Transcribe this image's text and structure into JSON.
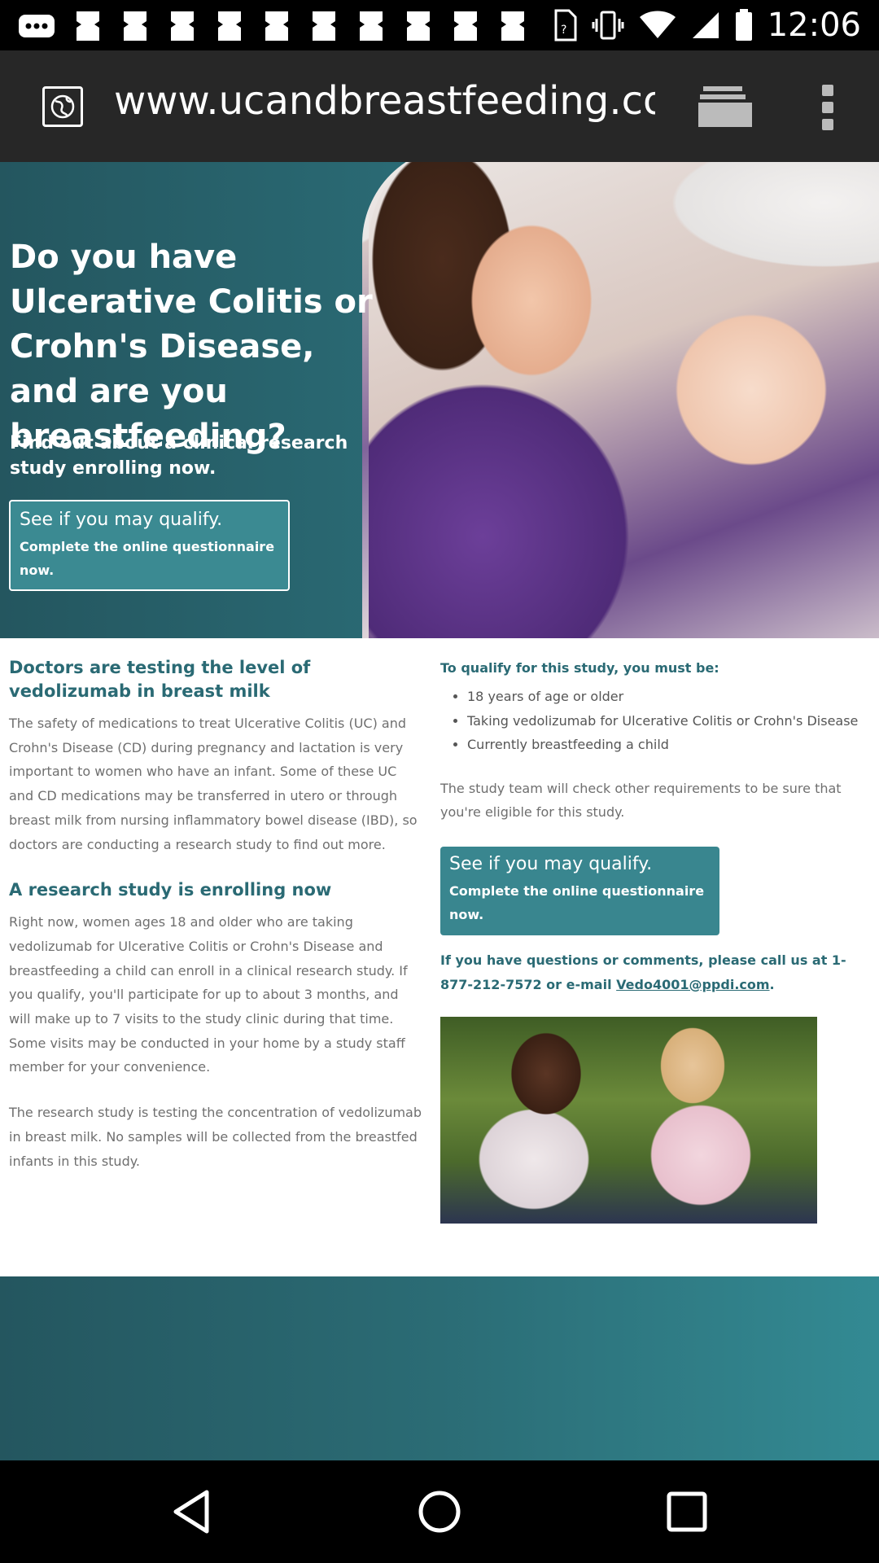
{
  "status_bar": {
    "time": "12:06",
    "icons": [
      "more-notifications-icon",
      "app-notification-icon",
      "app-notification-icon",
      "app-notification-icon",
      "app-notification-icon",
      "app-notification-icon",
      "app-notification-icon",
      "app-notification-icon",
      "app-notification-icon",
      "app-notification-icon",
      "app-notification-icon",
      "sim-icon",
      "vibrate-icon",
      "wifi-icon",
      "signal-icon",
      "battery-icon"
    ]
  },
  "browser": {
    "url": "www.ucandbreastfeeding.com/"
  },
  "hero": {
    "title": "Do you have Ulcerative Colitis or Crohn's Disease, and are you breastfeeding?",
    "subtitle": "Find out about a clinical research study enrolling now.",
    "qualify_title": "See if you may qualify.",
    "qualify_sub": "Complete the online questionnaire now."
  },
  "left_column": {
    "heading1": "Doctors are testing the level of vedolizumab in breast milk",
    "para1": "The safety of medications to treat Ulcerative Colitis (UC) and Crohn's Disease (CD) during pregnancy and lactation is very important to women who have an infant. Some of these UC and CD medications may be transferred in utero or through breast milk from nursing inflammatory bowel disease (IBD), so doctors are conducting a research study to find out more.",
    "heading2": "A research study is enrolling now",
    "para2": "Right now, women ages 18 and older who are taking vedolizumab for Ulcerative Colitis or Crohn's Disease and breastfeeding a child can enroll in a clinical research study. If you qualify, you'll participate for up to about 3 months, and will make up to 7 visits to the study clinic during that time. Some visits may be conducted in your home by a study staff member for your convenience.",
    "para3": "The research study is testing the concentration of vedolizumab in breast milk. No samples will be collected from the breastfed infants in this study."
  },
  "right_column": {
    "requirements_title": "To qualify for this study, you must be:",
    "requirements": [
      "18 years of age or older",
      "Taking vedolizumab for Ulcerative Colitis or Crohn's Disease",
      "Currently breastfeeding a child"
    ],
    "note": "The study team will check other requirements to be sure that you're eligible for this study.",
    "qualify_title": "See if you may qualify.",
    "qualify_sub": "Complete the online questionnaire now.",
    "contact_prefix": "If you have questions or comments, please call us at 1-877-212-7572 or e-mail ",
    "contact_email": "Vedo4001@ppdi.com",
    "contact_suffix": "."
  },
  "colors": {
    "teal_dark": "#24565f",
    "teal": "#2a6a74",
    "teal_button": "#39868f",
    "body_gray": "#6f6f6f"
  }
}
